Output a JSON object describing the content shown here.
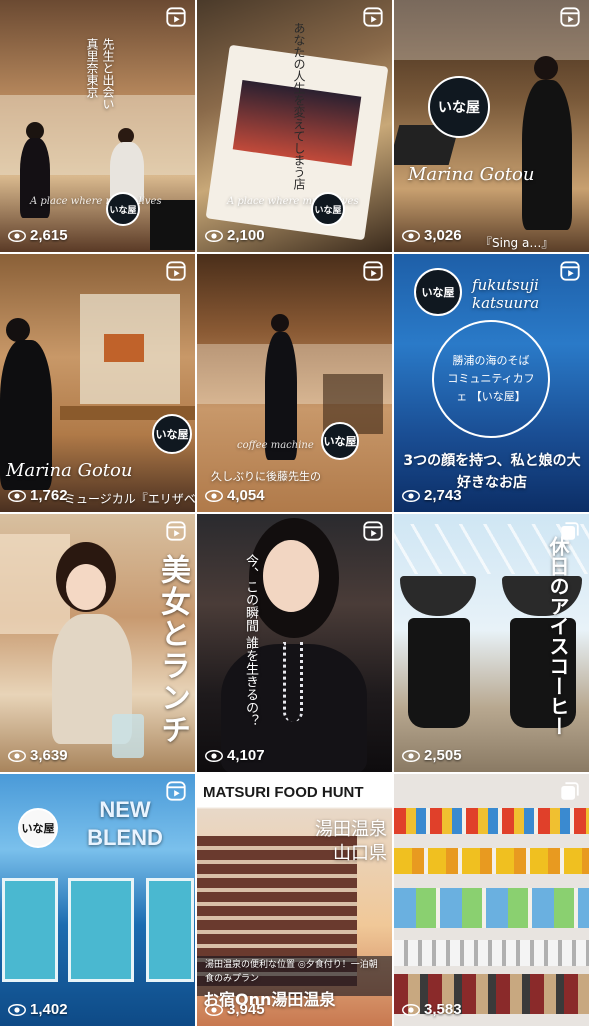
{
  "posts": [
    {
      "views": "2,615",
      "type": "reel",
      "overlay": "先生と出会い",
      "overlay2": "真里奈東京",
      "script": "A place where music lives"
    },
    {
      "views": "2,100",
      "type": "reel",
      "overlay": "あなたの人生を変えてしまう店",
      "script": "A place where music lives"
    },
    {
      "views": "3,026",
      "type": "reel",
      "script": "Marina Gotou",
      "bottom": "『Sing a…』"
    },
    {
      "views": "1,762",
      "type": "reel",
      "script": "Marina Gotou",
      "bottom": "ミュージカル『エリザベート』"
    },
    {
      "views": "4,054",
      "type": "reel",
      "script": "coffee machine",
      "bottom": "久しぶりに後藤先生の"
    },
    {
      "views": "2,743",
      "type": "reel",
      "title": "fukutsuji katsuura",
      "circle": "勝浦の海のそば コミュニティカフェ 【いな屋】",
      "bottom": "3つの顔を持つ、私と娘の大好きなお店"
    },
    {
      "views": "3,639",
      "type": "reel",
      "vertical": "美女とランチ"
    },
    {
      "views": "4,107",
      "type": "reel",
      "vertical": "今、この瞬間 誰を生きるの？"
    },
    {
      "views": "2,505",
      "type": "carousel",
      "vertical": "休日のアイスコーヒー"
    },
    {
      "views": "1,402",
      "type": "reel",
      "title": "NEW BLEND"
    },
    {
      "views": "3,945",
      "type": "carousel",
      "title": "MATSURI FOOD HUNT",
      "vertical": "湯田温泉 山口県",
      "caption": "湯田温泉の便利な位置 ◎夕食付り！一泊朝食のみプラン",
      "bottom": "お宿Onn湯田温泉"
    },
    {
      "views": "3,583",
      "type": "carousel"
    }
  ],
  "logo_text": "いな屋",
  "colors": {
    "overlay_text": "#ffffff",
    "reel_icon": "#ffffff"
  }
}
